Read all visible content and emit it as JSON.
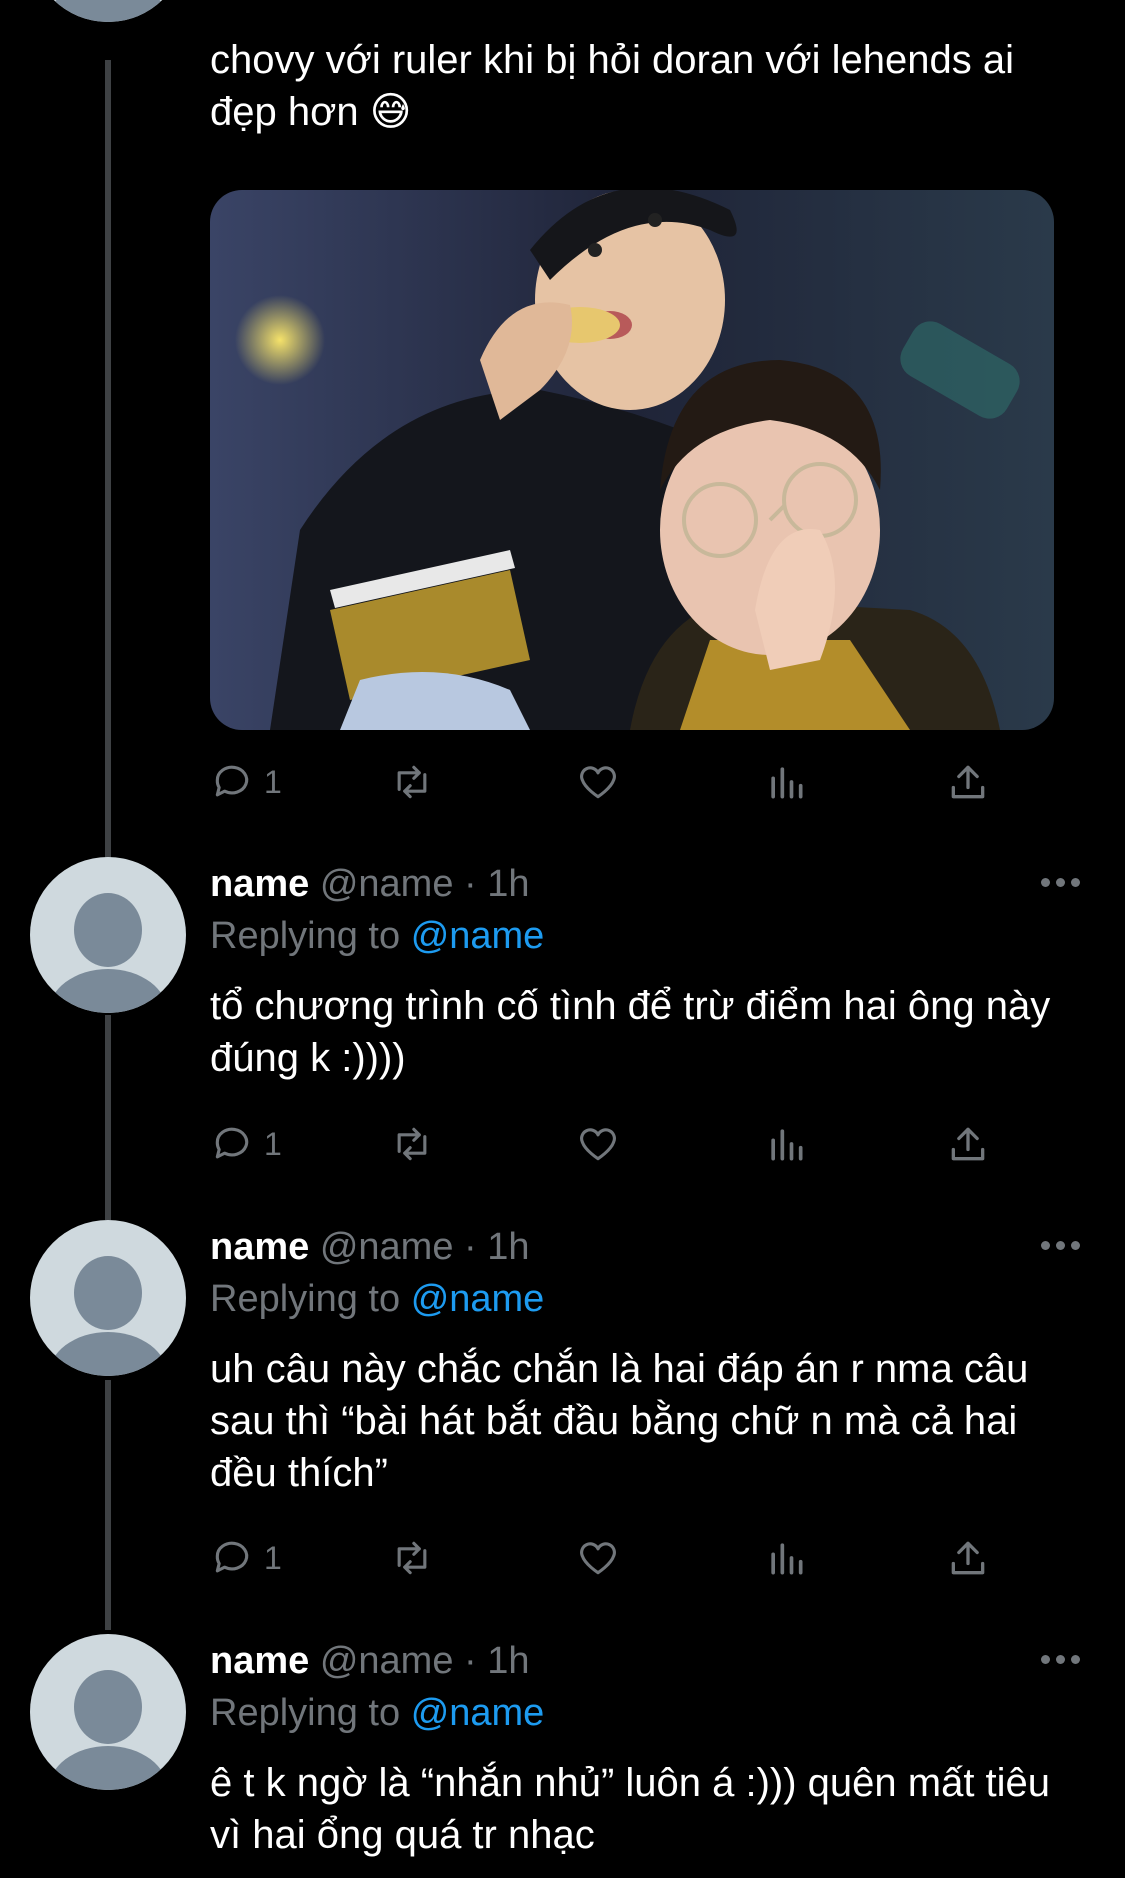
{
  "thread": {
    "main_post": {
      "text": "chovy với ruler khi bị hỏi doran với lehends ai đẹp hơn 😅",
      "reply_count": "1"
    },
    "replies": [
      {
        "display_name": "name",
        "handle": "@name",
        "separator": "·",
        "time": "1h",
        "replying_prefix": "Replying to",
        "replying_to": "@name",
        "text": "tổ chương trình cố tình để trừ điểm hai ông này đúng k :))))",
        "reply_count": "1"
      },
      {
        "display_name": "name",
        "handle": "@name",
        "separator": "·",
        "time": "1h",
        "replying_prefix": "Replying to",
        "replying_to": "@name",
        "text": "uh câu này chắc chắn là hai đáp án r nma câu sau thì “bài hát bắt đầu bằng chữ n mà cả hai đều thích”",
        "reply_count": "1"
      },
      {
        "display_name": "name",
        "handle": "@name",
        "separator": "·",
        "time": "1h",
        "replying_prefix": "Replying to",
        "replying_to": "@name",
        "text": "ê t k ngờ là “nhắn nhủ” luôn á :))) quên mất tiêu vì hai ổng quá tr nhạc"
      }
    ]
  },
  "icons": {
    "reply": "reply-icon",
    "retweet": "retweet-icon",
    "like": "heart-icon",
    "views": "views-icon",
    "share": "share-icon",
    "more": "more-icon"
  },
  "colors": {
    "background": "#000000",
    "text": "#ffffff",
    "secondary": "#71767b",
    "mention": "#1d9bf0",
    "thread_line": "#3e4144"
  }
}
